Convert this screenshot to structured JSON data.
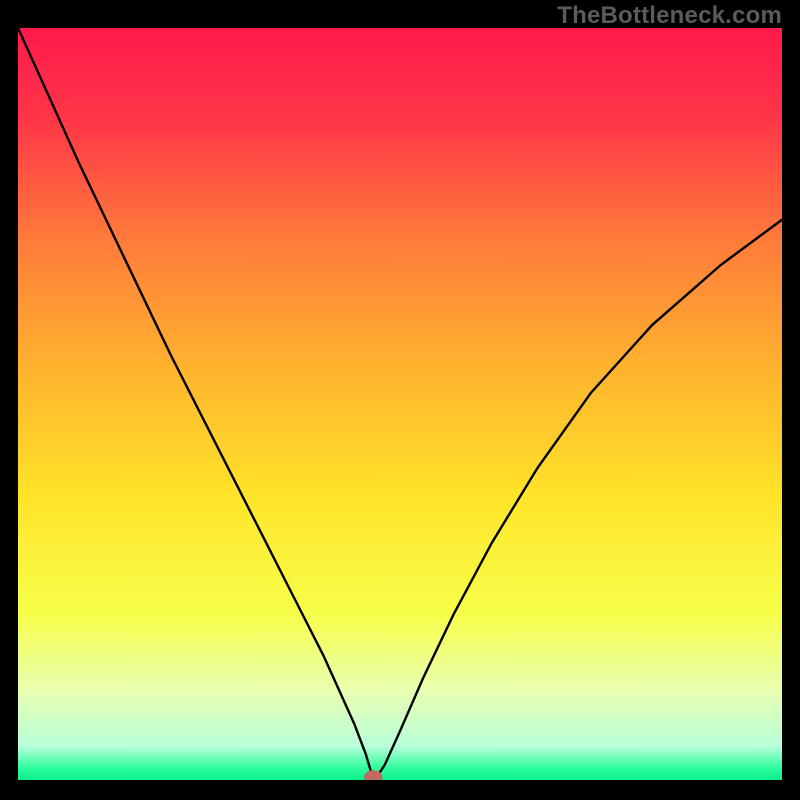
{
  "watermark": "TheBottleneck.com",
  "chart_data": {
    "type": "line",
    "title": "",
    "xlabel": "",
    "ylabel": "",
    "xlim": [
      0,
      100
    ],
    "ylim": [
      0,
      100
    ],
    "grid": false,
    "legend": false,
    "background_gradient": {
      "stops": [
        {
          "offset": 0.0,
          "color": "#ff1a4b"
        },
        {
          "offset": 0.12,
          "color": "#ff3548"
        },
        {
          "offset": 0.28,
          "color": "#ff7a3a"
        },
        {
          "offset": 0.45,
          "color": "#ffb22e"
        },
        {
          "offset": 0.62,
          "color": "#ffe329"
        },
        {
          "offset": 0.78,
          "color": "#f7ff4a"
        },
        {
          "offset": 0.88,
          "color": "#e8ffb0"
        },
        {
          "offset": 0.955,
          "color": "#b8ffd8"
        },
        {
          "offset": 0.985,
          "color": "#2bfd9a"
        },
        {
          "offset": 1.0,
          "color": "#0df08c"
        }
      ]
    },
    "series": [
      {
        "name": "bottleneck-curve",
        "color": "#000000",
        "x": [
          0.0,
          4.0,
          8.0,
          12.0,
          16.0,
          20.0,
          24.0,
          28.0,
          32.0,
          36.0,
          40.0,
          42.0,
          44.0,
          45.5,
          46.3,
          46.8,
          48.0,
          50.0,
          53.0,
          57.0,
          62.0,
          68.0,
          75.0,
          83.0,
          92.0,
          100.0
        ],
        "y": [
          100.0,
          91.0,
          82.0,
          73.5,
          65.0,
          56.5,
          48.5,
          40.5,
          32.5,
          24.5,
          16.5,
          12.0,
          7.5,
          3.5,
          0.8,
          0.2,
          2.0,
          6.5,
          13.5,
          22.0,
          31.5,
          41.5,
          51.5,
          60.5,
          68.5,
          74.5
        ]
      }
    ],
    "marker": {
      "name": "optimal-point",
      "x": 46.5,
      "y": 0.0,
      "rx": 1.2,
      "ry": 0.9,
      "fill": "#c26a5f"
    }
  }
}
